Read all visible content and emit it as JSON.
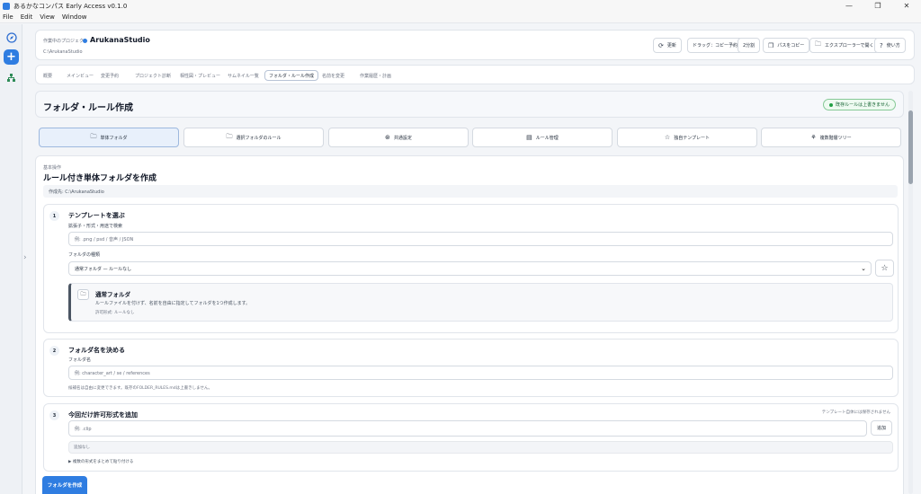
{
  "window": {
    "title": "あるかなコンパス Early Access v0.1.0",
    "controls": [
      "—",
      "❐",
      "✕"
    ]
  },
  "menu": [
    "File",
    "Edit",
    "View",
    "Window"
  ],
  "project": {
    "label": "作業中のプロジェクト",
    "name": "ArukanaStudio",
    "path": "C:\\ArukanaStudio",
    "buttons": [
      {
        "icon": "refresh-icon",
        "label": "更新"
      },
      {
        "icon": "",
        "label": "ドラッグ：コピー予約"
      },
      {
        "icon": "",
        "label": "2分割"
      },
      {
        "icon": "copy-icon",
        "label": "パスをコピー"
      },
      {
        "icon": "folder-icon",
        "label": "エクスプローラーで開く"
      },
      {
        "icon": "help-icon",
        "label": "使い方"
      }
    ]
  },
  "tabs": [
    "概要",
    "メインビュー",
    "変更予約",
    "プロジェクト診断",
    "相性図・プレビュー",
    "サムネイル一覧",
    "フォルダ・ルール作成",
    "名前を変更",
    "作業履歴・計画"
  ],
  "active_tab": "フォルダ・ルール作成",
  "section": {
    "title": "フォルダ・ルール作成",
    "status": "既存ルールは上書きません"
  },
  "modes": [
    {
      "icon": "folder-icon",
      "label": "単体フォルダ"
    },
    {
      "icon": "folder-rule-icon",
      "label": "選択フォルダのルール"
    },
    {
      "icon": "share-icon",
      "label": "共通設定"
    },
    {
      "icon": "document-icon",
      "label": "ルール管理"
    },
    {
      "icon": "star-icon",
      "label": "独自テンプレート"
    },
    {
      "icon": "tree-icon",
      "label": "複数階層ツリー"
    }
  ],
  "form": {
    "kicker": "基本操作",
    "title": "ルール付き単体フォルダを作成",
    "destination": "作成先: C:\\ArukanaStudio",
    "step1": {
      "num": "1",
      "title": "テンプレートを選ぶ",
      "search_label": "拡張子・形式・用途で検索",
      "search_placeholder": "例: .png / psd / 音声 / JSON",
      "type_label": "フォルダの種類",
      "type_value": "通常フォルダ — ルールなし",
      "preview_name": "通常フォルダ",
      "preview_desc": "ルールファイルを付けず、名前を自由に指定してフォルダを1つ作成します。",
      "preview_allow": "許可形式: ルールなし"
    },
    "step2": {
      "num": "2",
      "title": "フォルダ名を決める",
      "name_label": "フォルダ名",
      "name_placeholder": "例: character_art / se / references",
      "hint": "候補名は自由に変更できます。既存のFOLDER_RULES.mdは上書きしません。"
    },
    "step3": {
      "num": "3",
      "title": "今回だけ許可形式を追加",
      "note": "テンプレート自体には保存されません",
      "ext_placeholder": "例: .clip",
      "add_label": "追加",
      "none_label": "追加なし",
      "details_label": "▶ 複数の形式をまとめて貼り付ける"
    },
    "create_label": "フォルダを作成"
  }
}
